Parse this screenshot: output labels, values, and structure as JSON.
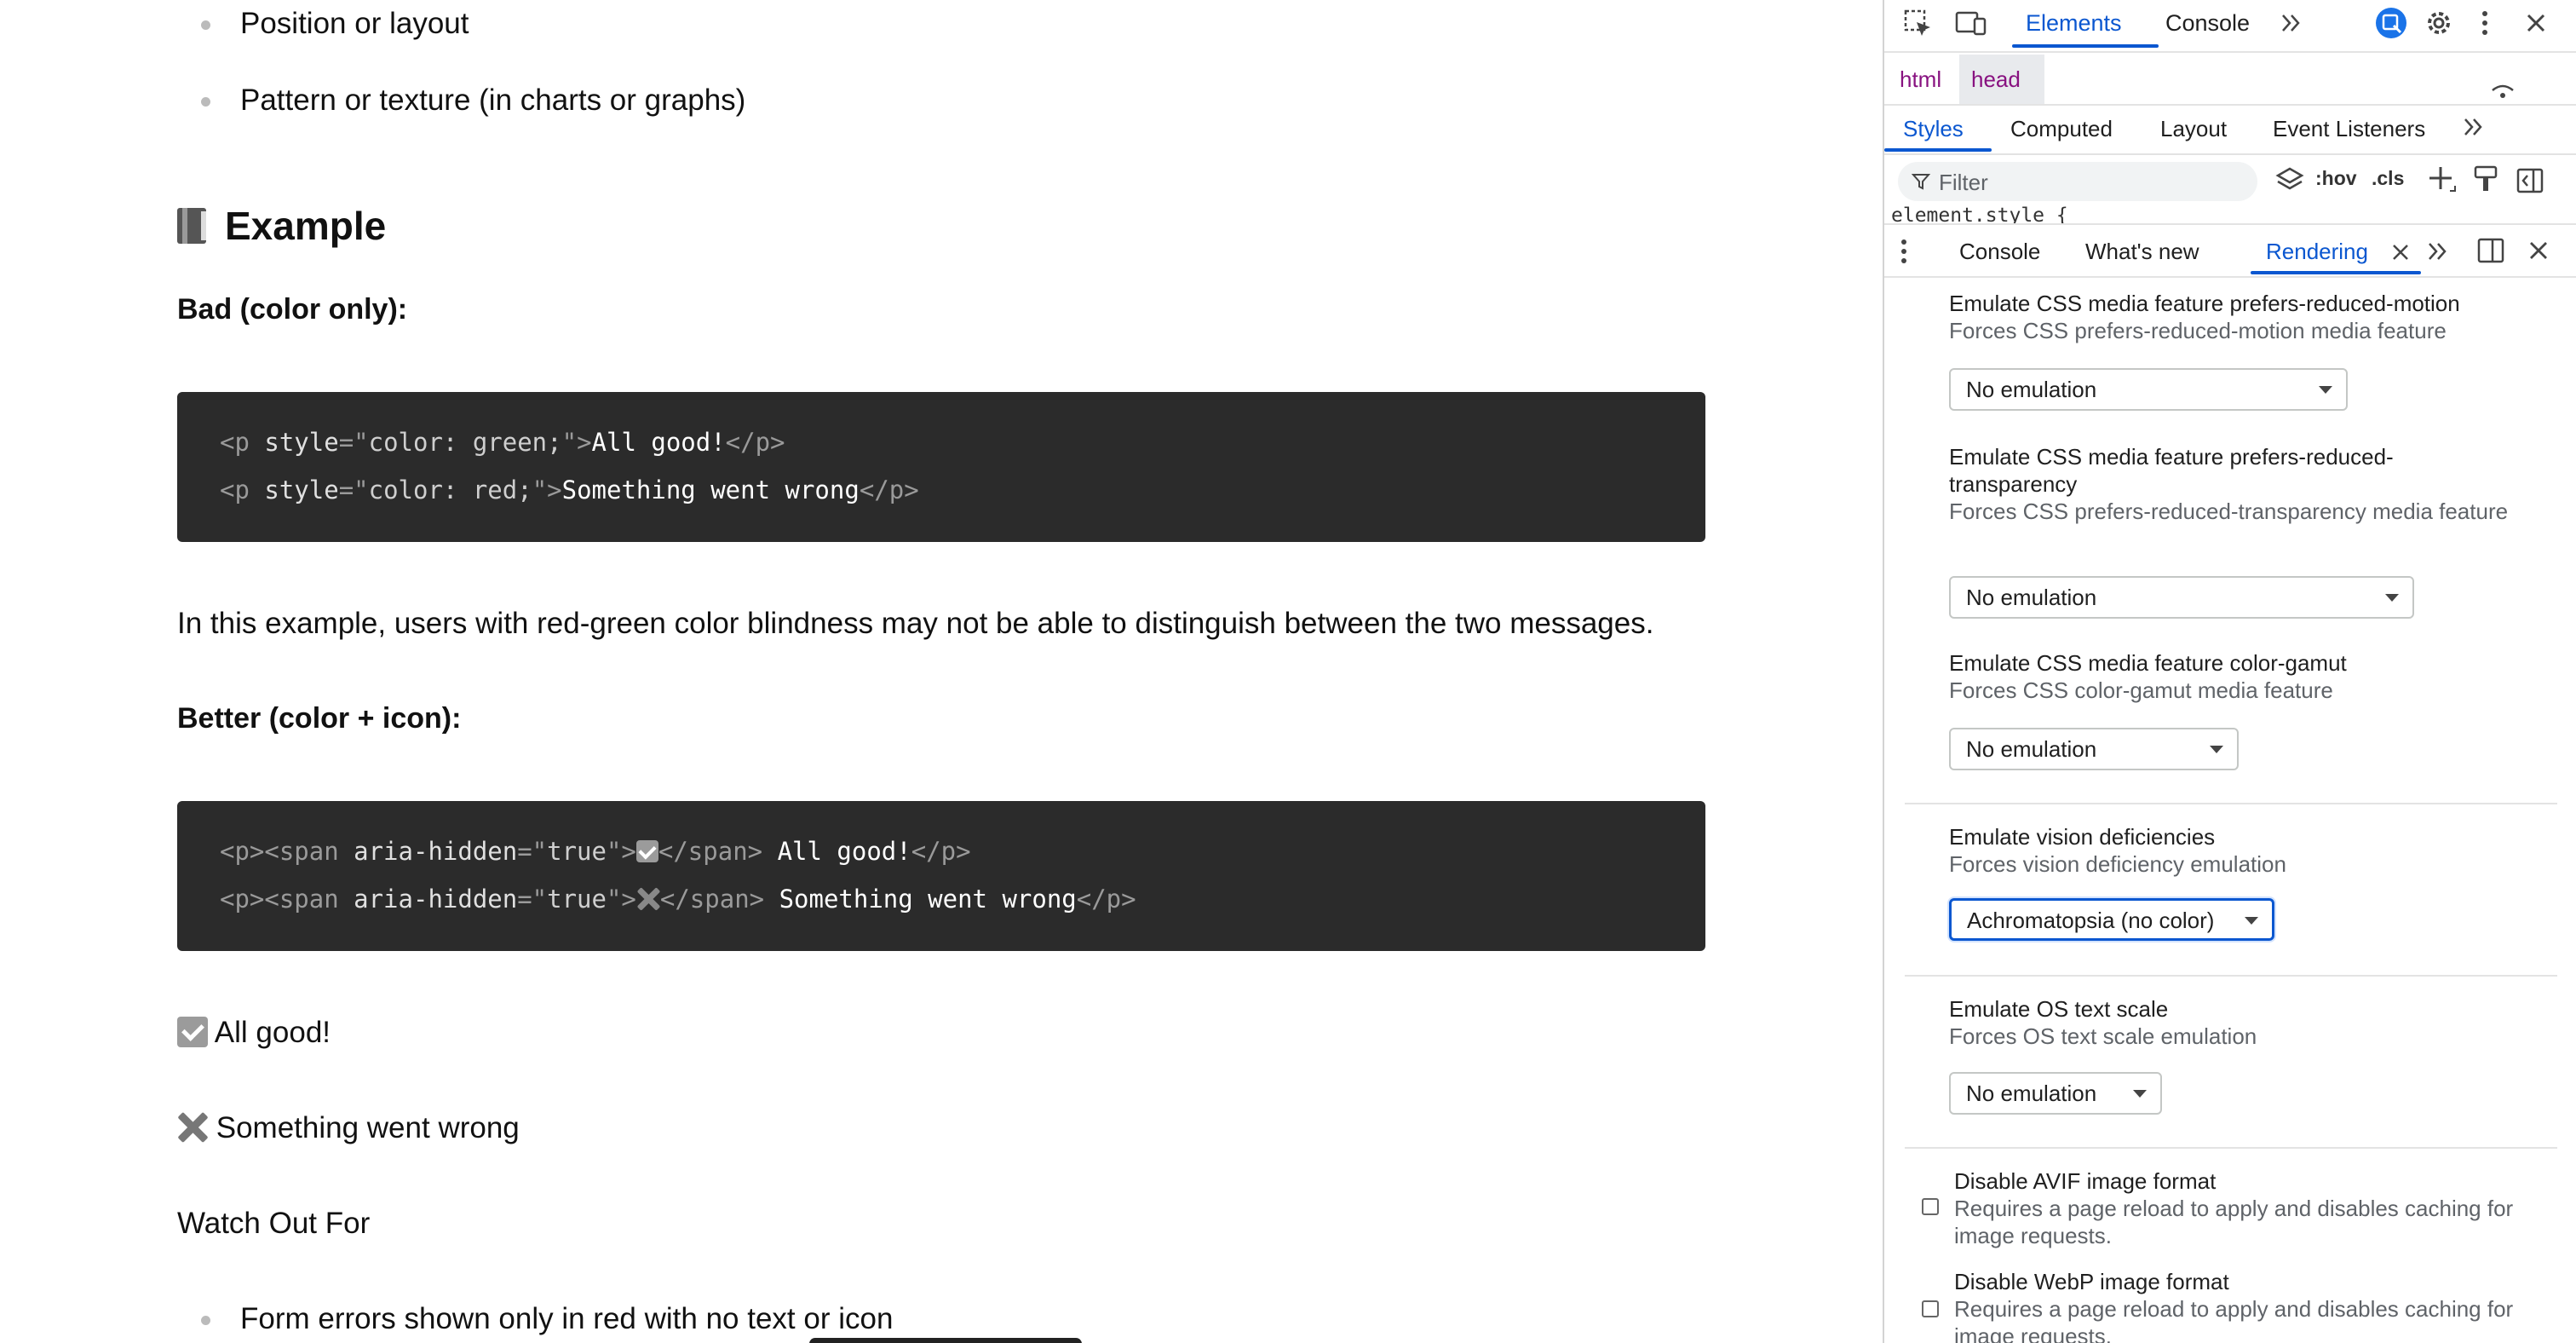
{
  "page": {
    "bullets_top": [
      "Position or layout",
      "Pattern or texture (in charts or graphs)"
    ],
    "example_heading": "Example",
    "bad_label": "Bad (color only):",
    "bad_code": [
      {
        "open": "<p ",
        "attr": "style",
        "eq": "=\"",
        "val": "color: green;",
        "close": "\">",
        "text": "All good!",
        "end": "</p>"
      },
      {
        "open": "<p ",
        "attr": "style",
        "eq": "=\"",
        "val": "color: red;",
        "close": "\">",
        "text": "Something went wrong",
        "end": "</p>"
      }
    ],
    "explanation": "In this example, users with red-green color blindness may not be able to distinguish between the two messages.",
    "better_label": "Better (color + icon):",
    "better_code": [
      {
        "open": "<p><span ",
        "attr": "aria-hidden",
        "eq": "=\"",
        "val": "true",
        "close": "\">",
        "end_span": "</span>",
        "text": " All good!",
        "end": "</p>"
      },
      {
        "open": "<p><span ",
        "attr": "aria-hidden",
        "eq": "=\"",
        "val": "true",
        "close": "\">",
        "end_span": "</span>",
        "text": " Something went wrong",
        "end": "</p>"
      }
    ],
    "demo_good": "All good!",
    "demo_bad": "Something went wrong",
    "watch_heading": "Watch Out For",
    "bullets_bottom": [
      "Form errors shown only in red with no text or icon"
    ]
  },
  "devtools": {
    "top_tabs": {
      "elements": "Elements",
      "console": "Console"
    },
    "breadcrumb": {
      "html": "html",
      "head": "head"
    },
    "sub_tabs": {
      "styles": "Styles",
      "computed": "Computed",
      "layout": "Layout",
      "event_listeners": "Event Listeners"
    },
    "filter_placeholder": "Filter",
    "hov": ":hov",
    "cls": ".cls",
    "element_style": "element.style {",
    "drawer_tabs": {
      "console": "Console",
      "whats_new": "What's new",
      "rendering": "Rendering"
    },
    "rendering": {
      "reduced_motion": {
        "title": "Emulate CSS media feature prefers-reduced-motion",
        "desc": "Forces CSS prefers-reduced-motion media feature",
        "value": "No emulation"
      },
      "reduced_transparency": {
        "title": "Emulate CSS media feature prefers-reduced-transparency",
        "desc": "Forces CSS prefers-reduced-transparency media feature",
        "value": "No emulation"
      },
      "color_gamut": {
        "title": "Emulate CSS media feature color-gamut",
        "desc": "Forces CSS color-gamut media feature",
        "value": "No emulation"
      },
      "vision": {
        "title": "Emulate vision deficiencies",
        "desc": "Forces vision deficiency emulation",
        "value": "Achromatopsia (no color)"
      },
      "text_scale": {
        "title": "Emulate OS text scale",
        "desc": "Forces OS text scale emulation",
        "value": "No emulation"
      },
      "avif": {
        "title": "Disable AVIF image format",
        "desc": "Requires a page reload to apply and disables caching for image requests."
      },
      "webp": {
        "title": "Disable WebP image format",
        "desc": "Requires a page reload to apply and disables caching for image requests."
      }
    }
  },
  "colors": {
    "accent": "#0b57d0",
    "code_bg": "#2b2b2b"
  }
}
